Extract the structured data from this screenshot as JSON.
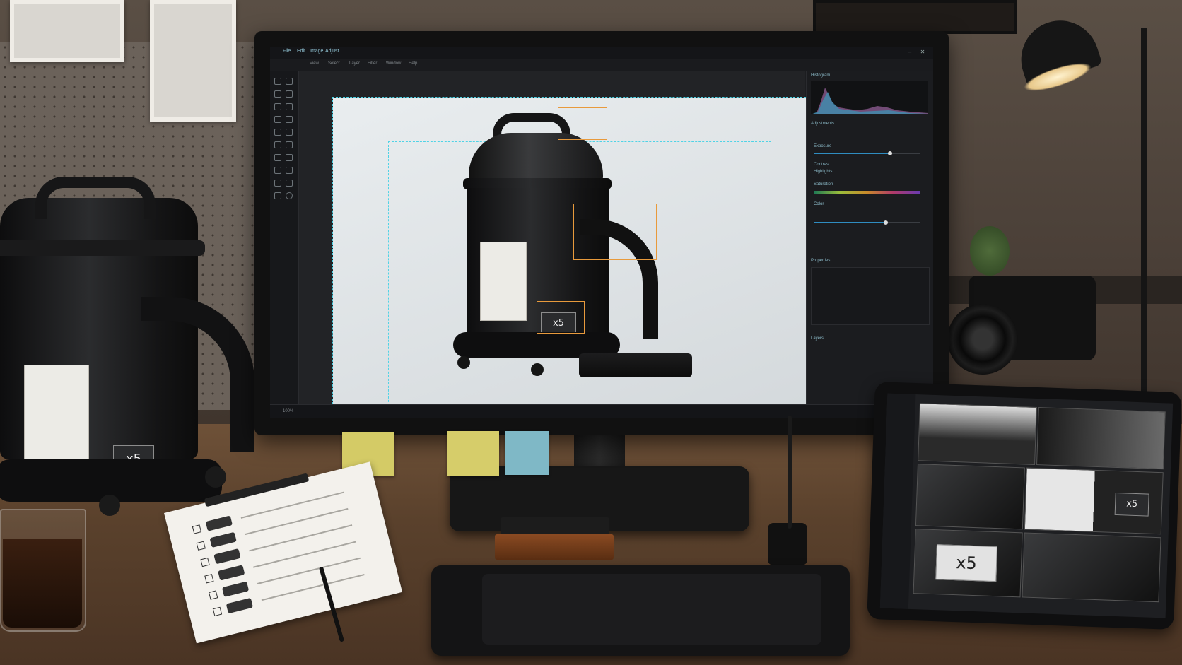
{
  "app": {
    "menu": [
      "File",
      "Edit",
      "Image",
      "Adjust"
    ],
    "submenu": [
      "View",
      "Select",
      "Layer",
      "Filter",
      "Window",
      "Help"
    ],
    "panel_title": "Histogram",
    "status": "100%"
  },
  "right_panel": {
    "sections": [
      "Adjustments",
      "Exposure",
      "Contrast",
      "Highlights",
      "Saturation",
      "Color",
      "Properties",
      "Layers"
    ],
    "exposure_level": 0.72,
    "saturation_level": 0.68
  },
  "product_label": {
    "count_text": "x5"
  },
  "physical_vacuum": {
    "count_text": "x5"
  },
  "tablet": {
    "count_text_large": "x5",
    "count_text_small": "x5"
  },
  "colors": {
    "accent_cyan": "#4fd3e6",
    "selection_orange": "#e89a3c",
    "slider_blue": "#2f8cc0",
    "sticky_yellow": "#d6cd6a",
    "sticky_blue": "#7fb8c6"
  },
  "icons": [
    "move-tool-icon",
    "crop-tool-icon",
    "brush-tool-icon",
    "eraser-tool-icon",
    "zoom-tool-icon",
    "window-close-icon"
  ]
}
